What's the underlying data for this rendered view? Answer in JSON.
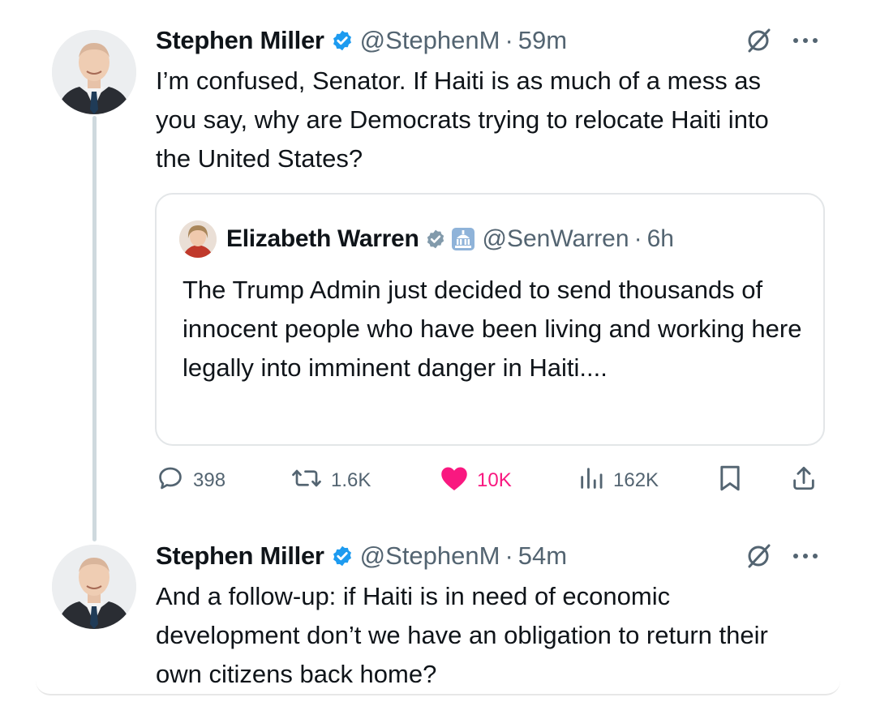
{
  "tweets": [
    {
      "author": "Stephen Miller",
      "handle": "@StephenM",
      "separator": "·",
      "time": "59m",
      "text": "I’m confused, Senator. If Haiti is as much of a mess as you say, why are Democrats trying to relocate Haiti into the United States?",
      "quote": {
        "author": "Elizabeth Warren",
        "handle": "@SenWarren",
        "separator": "·",
        "time": "6h",
        "text": "The Trump Admin just decided to send thousands of innocent people who have been living and working here legally into imminent danger in Haiti...."
      },
      "actions": {
        "replies": "398",
        "reposts": "1.6K",
        "likes": "10K",
        "views": "162K"
      }
    },
    {
      "author": "Stephen Miller",
      "handle": "@StephenM",
      "separator": "·",
      "time": "54m",
      "text": "And a follow-up: if Haiti is in need of economic development don’t we have an obligation to return their own citizens back home?"
    }
  ],
  "colors": {
    "verified": "#1d9bf0",
    "like": "#f91880",
    "muted": "#536471",
    "text": "#0f1419",
    "thread_line": "#cfd9de"
  },
  "icons": [
    "verified-badge-icon",
    "government-badge-icon",
    "grok-icon",
    "more-icon",
    "reply-icon",
    "repost-icon",
    "heart-icon",
    "views-icon",
    "bookmark-icon",
    "share-icon"
  ]
}
